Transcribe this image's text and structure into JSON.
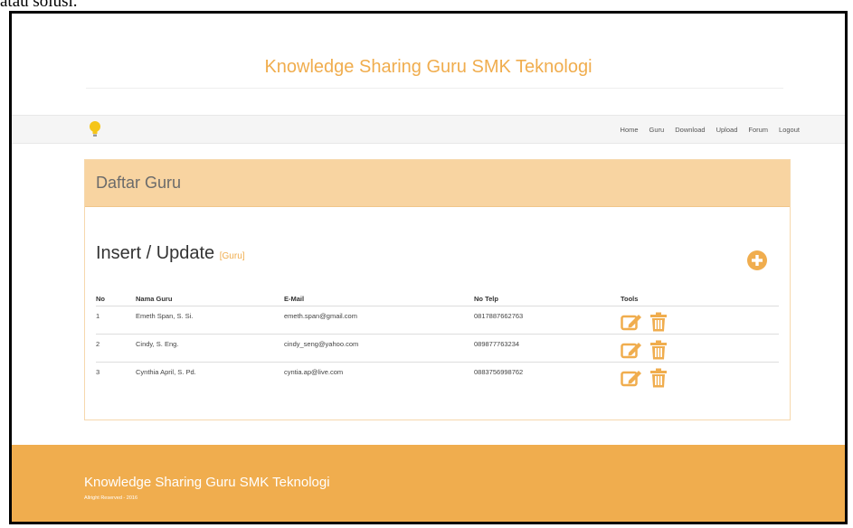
{
  "caption": "atau solusi.",
  "site": {
    "title": "Knowledge Sharing Guru SMK Teknologi"
  },
  "nav": {
    "items": [
      "Home",
      "Guru",
      "Download",
      "Upload",
      "Forum",
      "Logout"
    ]
  },
  "panel": {
    "title": "Daftar Guru"
  },
  "section": {
    "title": "Insert / Update",
    "subtitle": "[Guru]"
  },
  "table": {
    "headers": [
      "No",
      "Nama Guru",
      "E-Mail",
      "No Telp",
      "Tools"
    ],
    "rows": [
      {
        "no": "1",
        "nama": "Emeth Span, S. Si.",
        "email": "emeth.span@gmail.com",
        "telp": "0817887662763"
      },
      {
        "no": "2",
        "nama": "Cindy, S. Eng.",
        "email": "cindy_seng@yahoo.com",
        "telp": "089877763234"
      },
      {
        "no": "3",
        "nama": "Cynthia April, S. Pd.",
        "email": "cyntia.ap@live.com",
        "telp": "0883756998762"
      }
    ]
  },
  "footer": {
    "title": "Knowledge Sharing Guru SMK Teknologi",
    "subtitle": "Allright Reserved - 2016"
  },
  "colors": {
    "accent": "#f0ad4e",
    "panel_heading": "#f8d4a1",
    "nav_bg": "#f5f5f5"
  },
  "icons": [
    "lightbulb-icon",
    "add-circle-icon",
    "edit-icon",
    "trash-icon"
  ]
}
